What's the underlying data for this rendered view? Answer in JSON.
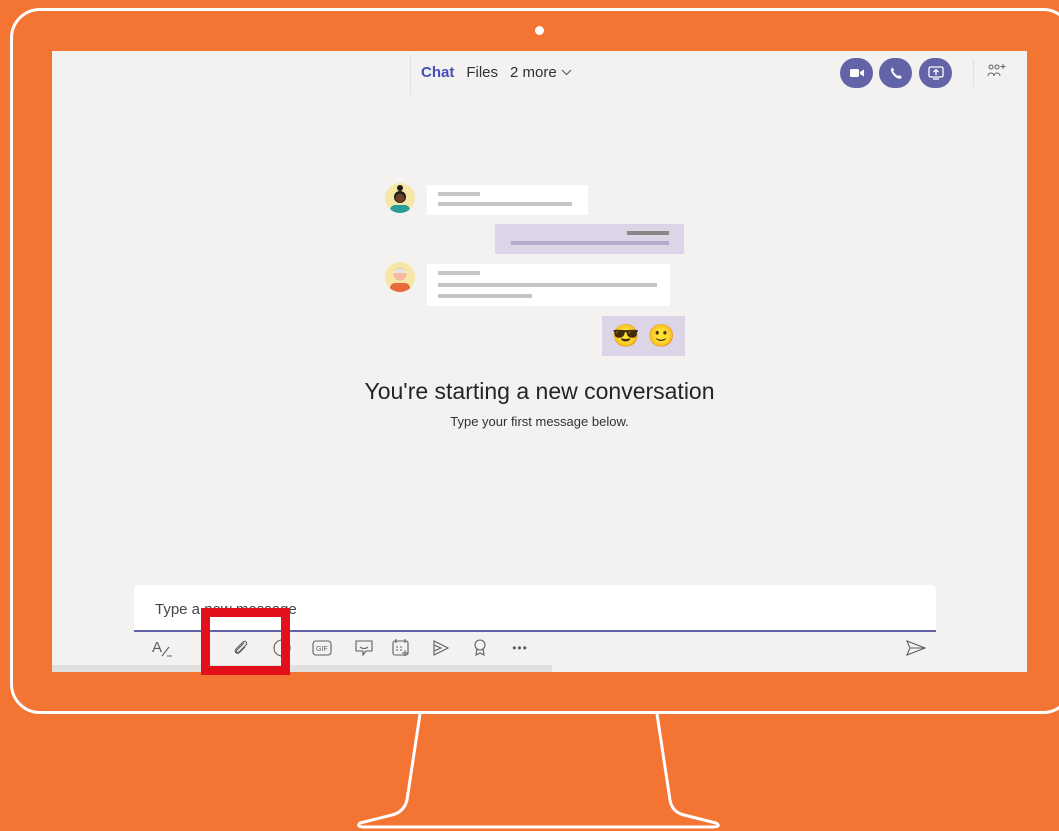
{
  "header": {
    "tabs": [
      {
        "label": "Chat",
        "active": true
      },
      {
        "label": "Files",
        "active": false
      },
      {
        "label": "2 more",
        "active": false
      }
    ],
    "actions": [
      {
        "icon": "video-call-icon"
      },
      {
        "icon": "audio-call-icon"
      },
      {
        "icon": "share-screen-icon"
      },
      {
        "icon": "add-people-icon"
      }
    ]
  },
  "emoji": [
    "😎",
    "🙂"
  ],
  "empty_state": {
    "title": "You're starting a new conversation",
    "subtitle": "Type your first message below."
  },
  "compose": {
    "placeholder": "Type a new message"
  },
  "toolbar": {
    "icons": [
      "format-icon",
      "attach-icon",
      "emoji-icon",
      "gif-icon",
      "sticker-icon",
      "schedule-meeting-icon",
      "stream-icon",
      "praise-icon",
      "more-options-icon",
      "send-icon"
    ],
    "gif_label": "GIF",
    "more_label": "•••",
    "format_label": "A"
  },
  "colors": {
    "background": "#f47433",
    "accent": "#6264a7",
    "highlight": "#e2101a"
  }
}
